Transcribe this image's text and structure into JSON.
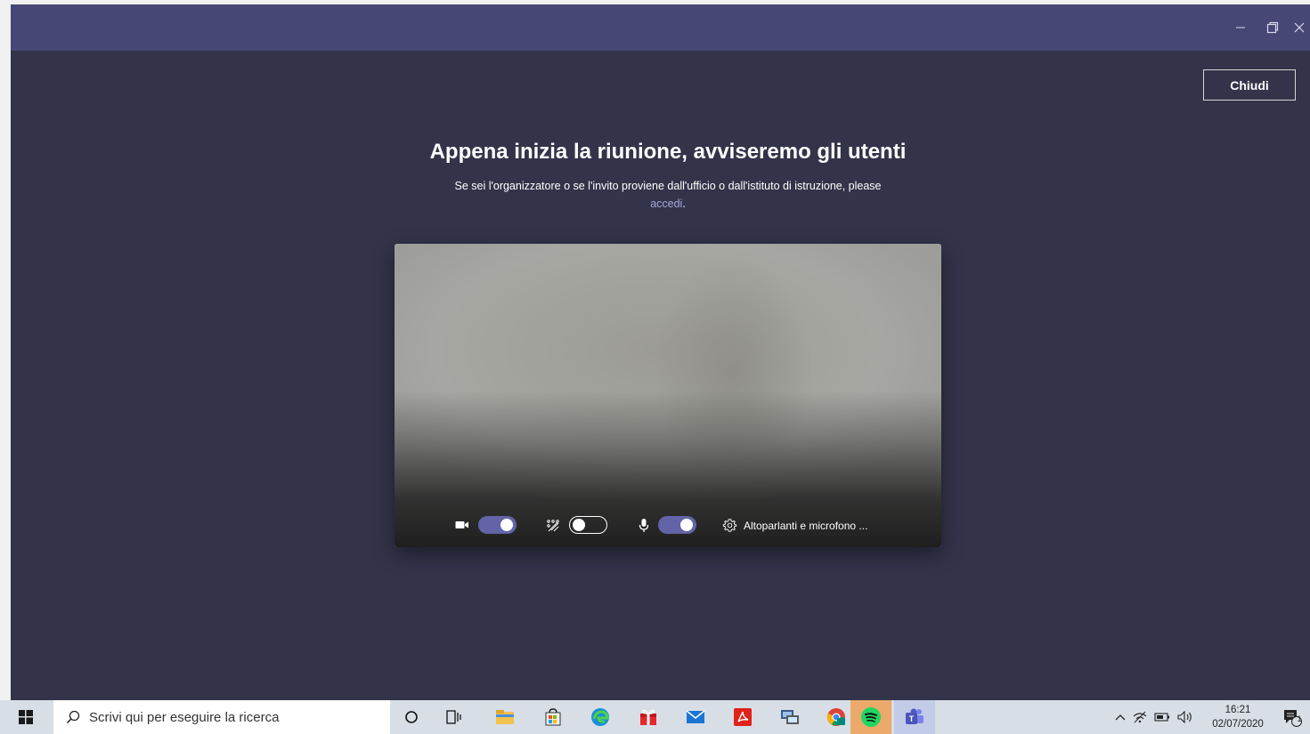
{
  "window": {
    "minimize_icon": "minimize-icon",
    "maximize_icon": "restore-icon",
    "close_icon": "close-icon"
  },
  "header": {
    "close_label": "Chiudi"
  },
  "main": {
    "title": "Appena inizia la riunione, avviseremo gli utenti",
    "subtitle": "Se sei l'organizzatore o se l'invito proviene dall'ufficio o dall'istituto di istruzione, please",
    "signin_link": "accedi",
    "signin_suffix": "."
  },
  "preview": {
    "camera_toggle": "on",
    "blur_toggle": "off",
    "mic_toggle": "on",
    "devices_label": "Altoparlanti e microfono ..."
  },
  "taskbar": {
    "search_placeholder": "Scrivi qui per eseguire la ricerca",
    "time": "16:21",
    "date": "02/07/2020",
    "notification_count": "1"
  },
  "colors": {
    "titlebar": "#464775",
    "background": "#33344a",
    "accent": "#6264a7",
    "link": "#a6a7dc"
  }
}
